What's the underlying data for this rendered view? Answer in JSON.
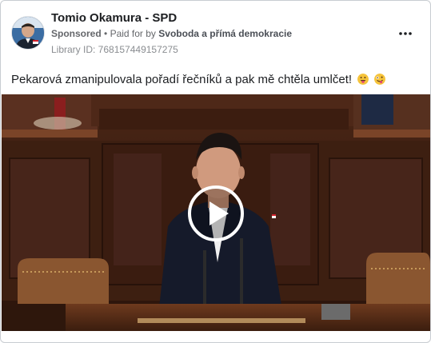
{
  "advertiser": {
    "name": "Tomio Okamura - SPD",
    "sponsored_label": "Sponsored",
    "paid_for_prefix": "Paid for by",
    "payer": "Svoboda a přímá demokracie",
    "library_id": "Library ID: 768157449157275"
  },
  "post": {
    "caption": "Pekarová zmanipulovala pořadí řečníků a pak mě chtěla umlčet!",
    "emojis": [
      "grinning-face-with-tongue-icon",
      "zany-face-icon"
    ]
  },
  "colors": {
    "name_text": "#1c1e21",
    "meta_text": "#65676b",
    "card_border": "#c8ccd1",
    "video_background": "#3a1d12",
    "play_button": "#ffffff"
  },
  "icons": {
    "more_menu": "ellipsis-horizontal-icon",
    "play": "play-icon"
  }
}
